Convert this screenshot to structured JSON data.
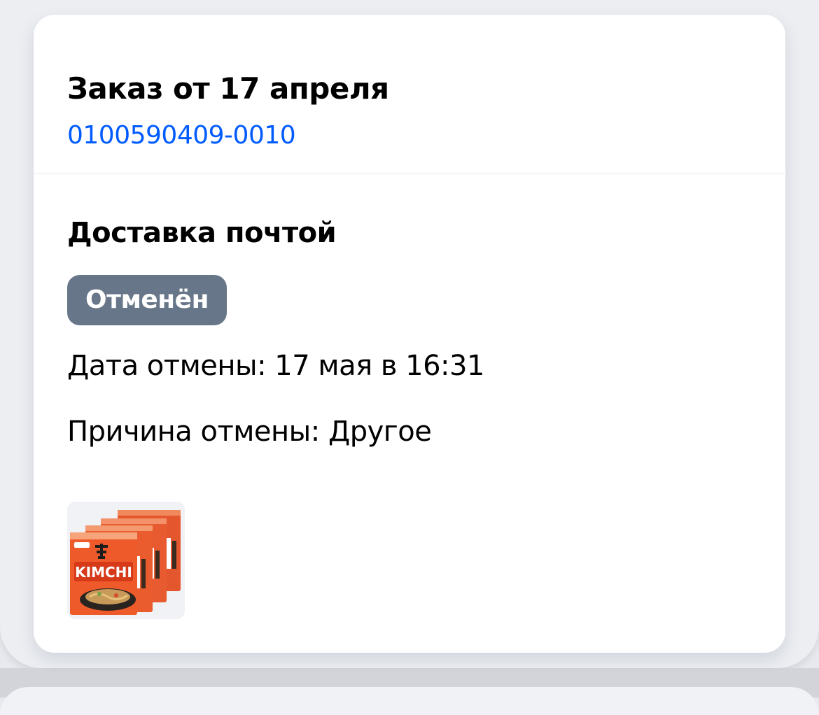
{
  "order": {
    "title": "Заказ от 17 апреля",
    "number": "0100590409-0010"
  },
  "shipment": {
    "title": "Доставка почтой",
    "status_badge": "Отменён",
    "cancel_date": "Дата отмены: 17 мая в 16:31",
    "cancel_reason": "Причина отмены: Другое"
  },
  "products": [
    {
      "image_name": "kimchi-noodles-image",
      "package_text": "KIMCHI"
    }
  ],
  "colors": {
    "link": "#005bff",
    "status_badge_bg": "#677689",
    "card_bg": "#ffffff",
    "page_bg": "#e7e9ee"
  }
}
